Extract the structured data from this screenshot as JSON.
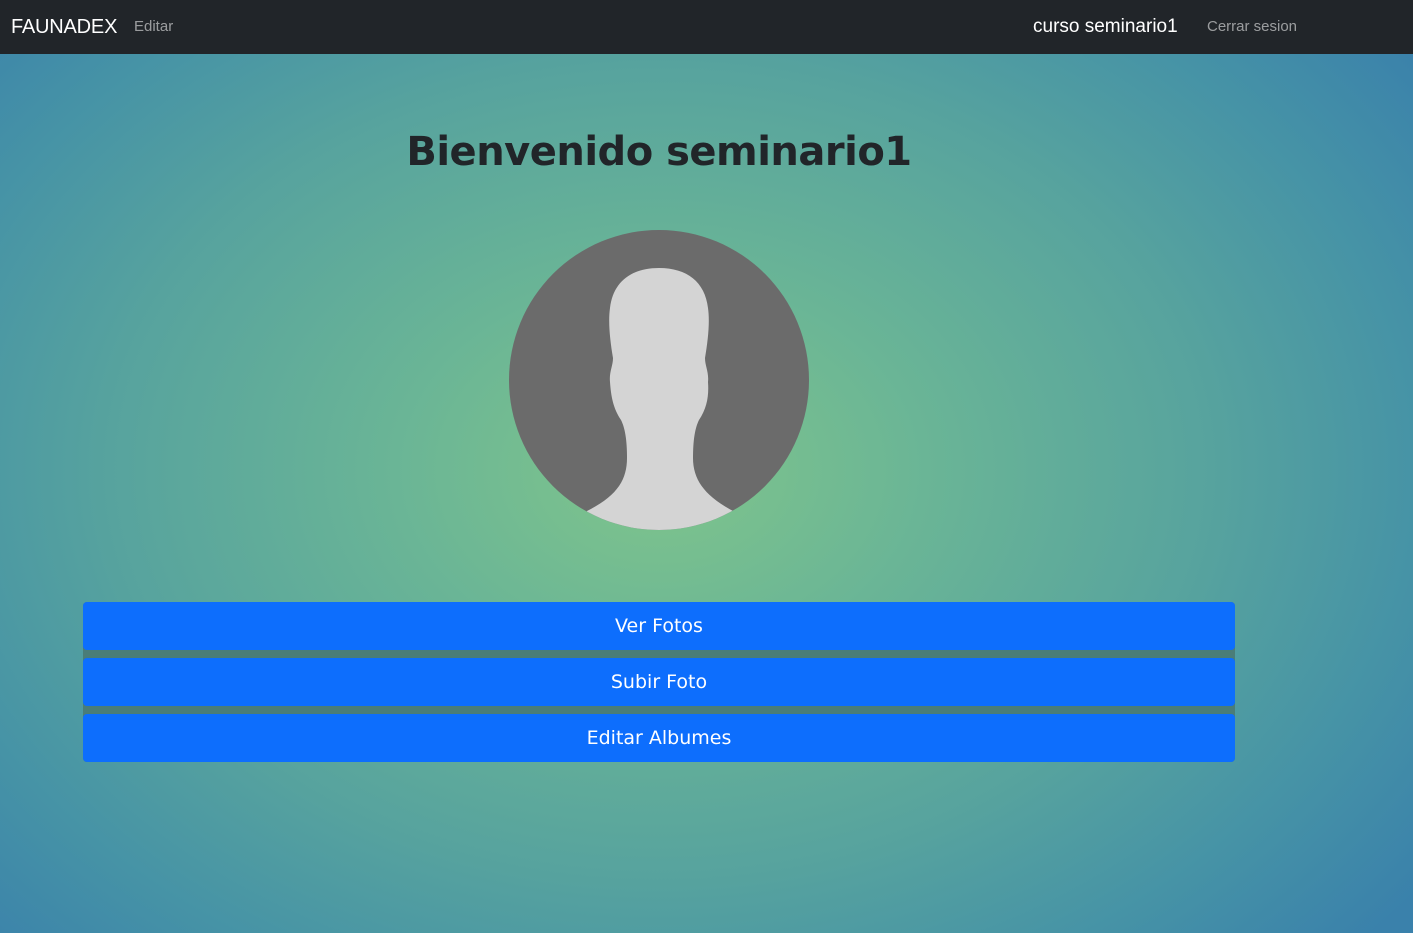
{
  "navbar": {
    "brand": "FAUNADEX",
    "edit_link": "Editar",
    "user_display": "curso seminario1",
    "logout_link": "Cerrar sesion"
  },
  "main": {
    "welcome_title": "Bienvenido seminario1",
    "avatar_icon": "default-user-avatar-icon",
    "buttons": [
      {
        "label": "Ver Fotos"
      },
      {
        "label": "Subir Foto"
      },
      {
        "label": "Editar Albumes"
      }
    ]
  },
  "colors": {
    "navbar_bg": "#212529",
    "button_primary": "#0d6efd",
    "avatar_bg": "#6b6b6b",
    "avatar_silhouette": "#d4d4d4"
  }
}
